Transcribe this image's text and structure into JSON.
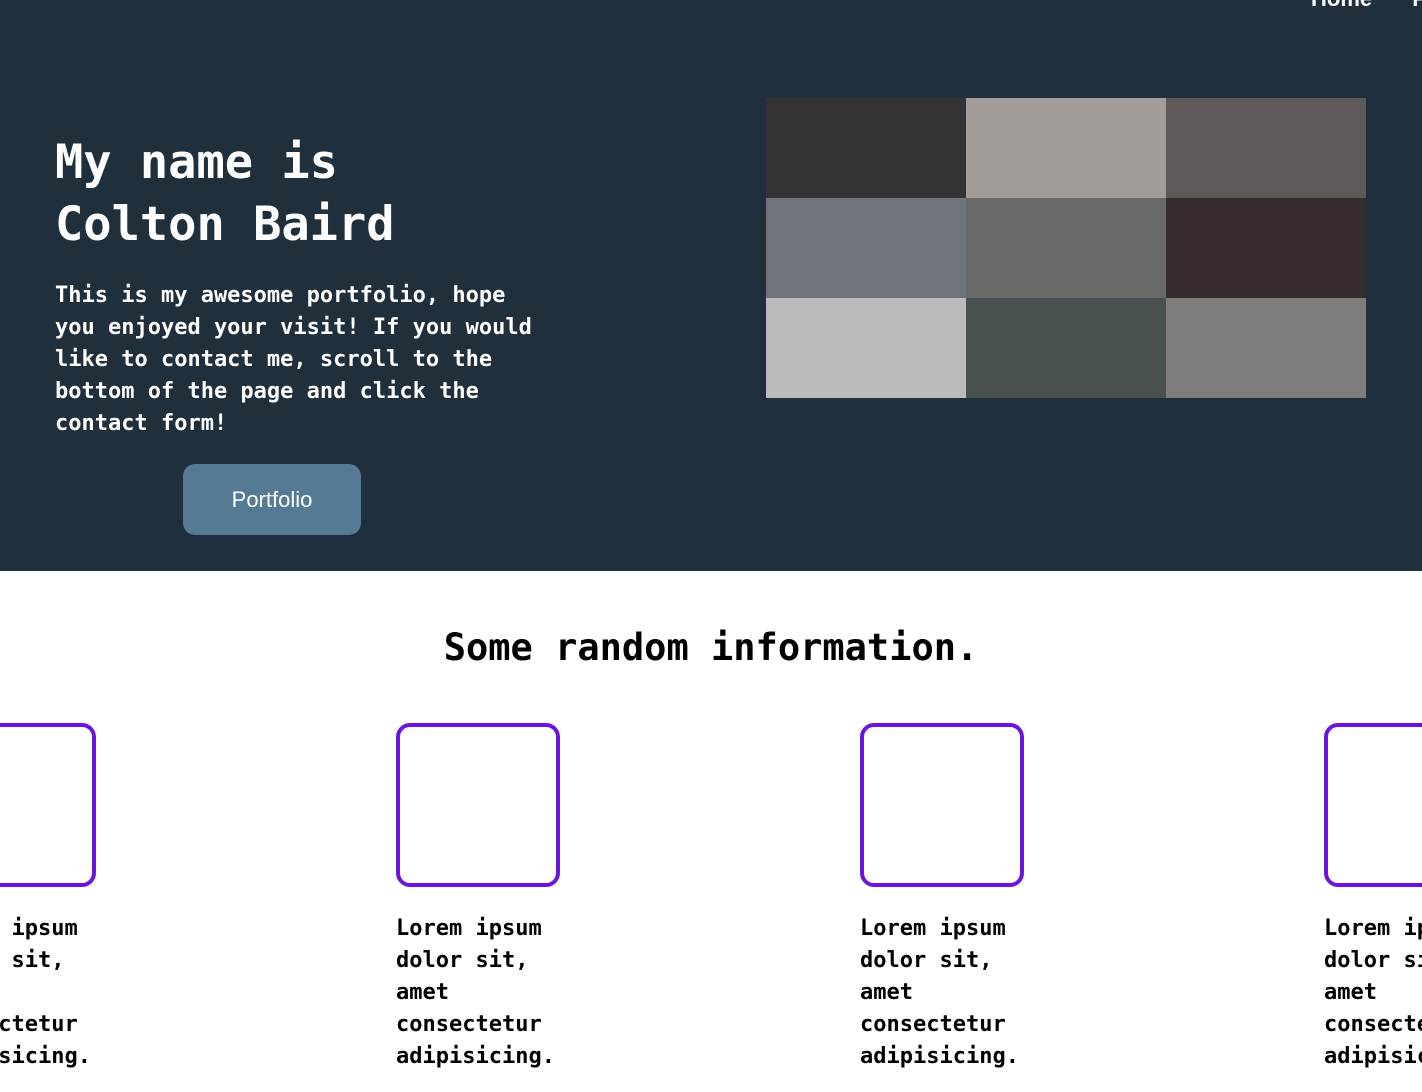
{
  "nav": {
    "items": [
      {
        "label": "Home"
      },
      {
        "label": "Portfolio"
      }
    ]
  },
  "hero": {
    "title": "My name is Colton Baird",
    "description": "This is my awesome portfolio, hope you enjoyed your visit! If you would like to contact me, scroll to the bottom of the page and click the contact form!",
    "button_label": "Portfolio",
    "mosaic_colors": [
      "#353234",
      "#a29c99",
      "#5e5956",
      "#6f747b",
      "#696968",
      "#372d31",
      "#bbbbbb",
      "#485050",
      "#807c79"
    ]
  },
  "info": {
    "title": "Some random information.",
    "card_color": "#6f12e0",
    "cards": [
      {
        "text": "Lorem ipsum dolor sit, amet consectetur adipisicing."
      },
      {
        "text": "Lorem ipsum dolor sit, amet consectetur adipisicing."
      },
      {
        "text": "Lorem ipsum dolor sit, amet consectetur adipisicing."
      },
      {
        "text": "Lorem ipsum dolor sit, amet consectetur adipisicing."
      }
    ]
  }
}
